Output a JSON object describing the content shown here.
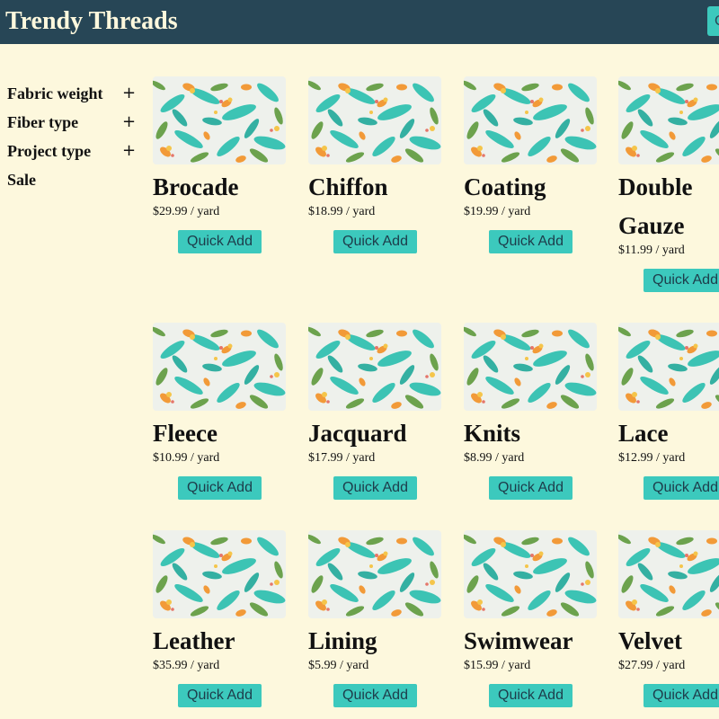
{
  "header": {
    "brand": "Trendy Threads",
    "button_label": "C",
    "background": "#274656",
    "accent": "#3cc9bd"
  },
  "sidebar": {
    "filters": [
      {
        "label": "Fabric weight",
        "icon": "plus-icon",
        "expand": "+"
      },
      {
        "label": "Fiber type",
        "icon": "plus-icon",
        "expand": "+"
      },
      {
        "label": "Project type",
        "icon": "plus-icon",
        "expand": "+"
      },
      {
        "label": "Sale"
      }
    ]
  },
  "products": [
    {
      "name": "Brocade",
      "price": "$29.99",
      "unit": "/ yard",
      "action": "Quick Add"
    },
    {
      "name": "Chiffon",
      "price": "$18.99",
      "unit": "/ yard",
      "action": "Quick Add"
    },
    {
      "name": "Coating",
      "price": "$19.99",
      "unit": "/ yard",
      "action": "Quick Add"
    },
    {
      "name": "Double Gauze",
      "price": "$11.99",
      "unit": "/ yard",
      "action": "Quick Add"
    },
    {
      "name": "Fleece",
      "price": "$10.99",
      "unit": "/ yard",
      "action": "Quick Add"
    },
    {
      "name": "Jacquard",
      "price": "$17.99",
      "unit": "/ yard",
      "action": "Quick Add"
    },
    {
      "name": "Knits",
      "price": "$8.99",
      "unit": "/ yard",
      "action": "Quick Add"
    },
    {
      "name": "Lace",
      "price": "$12.99",
      "unit": "/ yard",
      "action": "Quick Add"
    },
    {
      "name": "Leather",
      "price": "$35.99",
      "unit": "/ yard",
      "action": "Quick Add"
    },
    {
      "name": "Lining",
      "price": "$5.99",
      "unit": "/ yard",
      "action": "Quick Add"
    },
    {
      "name": "Swimwear",
      "price": "$15.99",
      "unit": "/ yard",
      "action": "Quick Add"
    },
    {
      "name": "Velvet",
      "price": "$27.99",
      "unit": "/ yard",
      "action": "Quick Add"
    }
  ]
}
